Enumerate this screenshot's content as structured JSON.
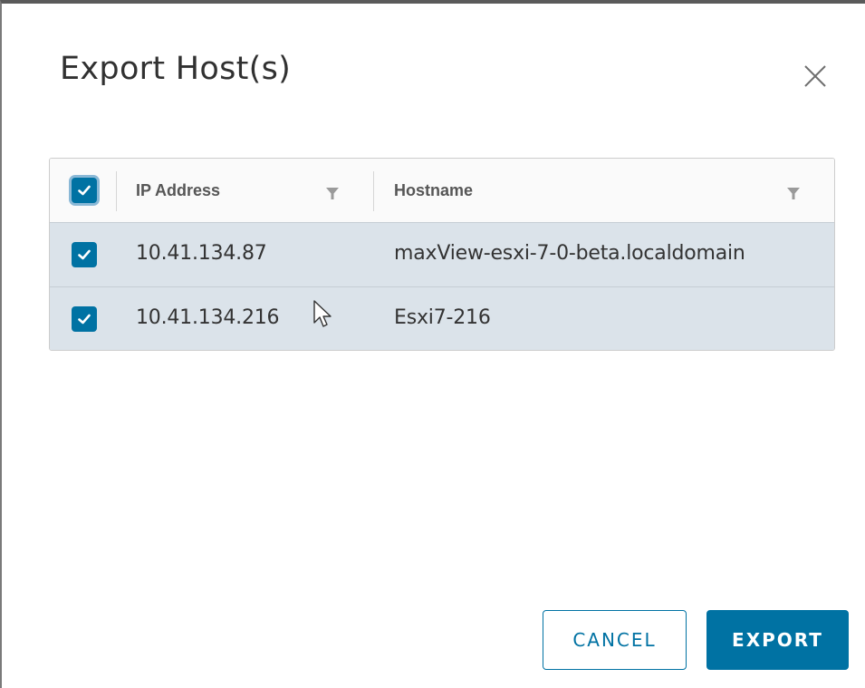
{
  "dialog": {
    "title": "Export Host(s)",
    "close_icon": "close-icon"
  },
  "grid": {
    "select_all_checked": true,
    "columns": [
      {
        "label": "IP Address",
        "filter_icon": "filter-icon"
      },
      {
        "label": "Hostname",
        "filter_icon": "filter-icon"
      }
    ],
    "rows": [
      {
        "checked": true,
        "ip": "10.41.134.87",
        "hostname": "maxView-esxi-7-0-beta.localdomain"
      },
      {
        "checked": true,
        "ip": "10.41.134.216",
        "hostname": "Esxi7-216"
      }
    ]
  },
  "footer": {
    "cancel_label": "CANCEL",
    "export_label": "EXPORT"
  },
  "colors": {
    "accent": "#0072a3",
    "selected_row": "#dbe3ea"
  }
}
